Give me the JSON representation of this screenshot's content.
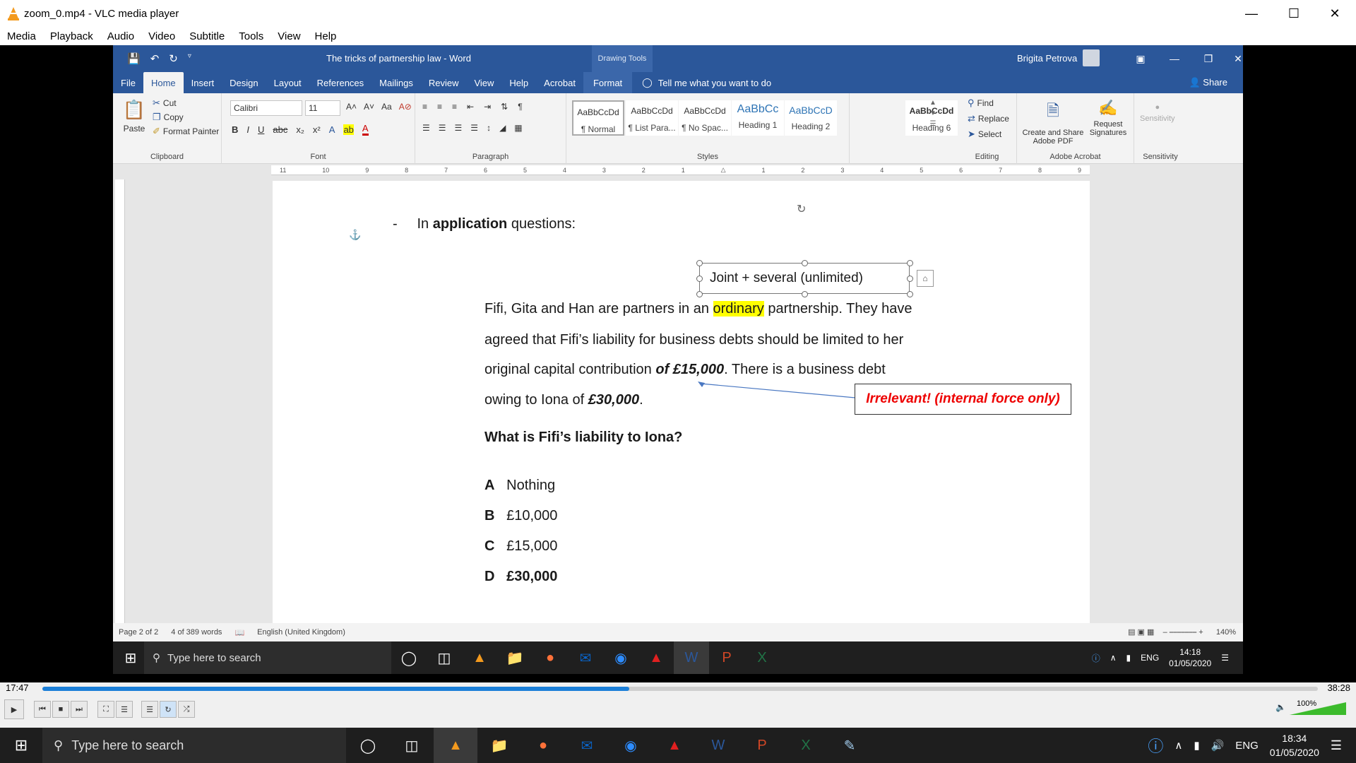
{
  "vlc": {
    "title": "zoom_0.mp4 - VLC media player",
    "menu": [
      "Media",
      "Playback",
      "Audio",
      "Video",
      "Subtitle",
      "Tools",
      "View",
      "Help"
    ],
    "time_elapsed": "17:47",
    "time_total": "38:28",
    "progress_fraction": 0.46,
    "volume": "100%"
  },
  "word": {
    "doc_title": "The tricks of partnership law  -  Word",
    "drawing_tools": "Drawing Tools",
    "user": "Brigita Petrova",
    "tabs": [
      "File",
      "Home",
      "Insert",
      "Design",
      "Layout",
      "References",
      "Mailings",
      "Review",
      "View",
      "Help",
      "Acrobat",
      "Format"
    ],
    "tell_me": "Tell me what you want to do",
    "share": "Share",
    "clipboard": {
      "paste": "Paste",
      "cut": "Cut",
      "copy": "Copy",
      "format_painter": "Format Painter",
      "label": "Clipboard"
    },
    "font": {
      "name": "Calibri",
      "size": "11",
      "label": "Font"
    },
    "paragraph_label": "Paragraph",
    "styles": {
      "label": "Styles",
      "items": [
        {
          "sample": "AaBbCcDd",
          "name": "¶ Normal"
        },
        {
          "sample": "AaBbCcDd",
          "name": "¶ List Para..."
        },
        {
          "sample": "AaBbCcDd",
          "name": "¶ No Spac..."
        },
        {
          "sample": "AaBbCc",
          "name": "Heading 1"
        },
        {
          "sample": "AaBbCcD",
          "name": "Heading 2"
        },
        {
          "sample": "AaBbCcDd",
          "name": "Heading 6"
        }
      ]
    },
    "editing": {
      "find": "Find",
      "replace": "Replace",
      "select": "Select",
      "label": "Editing"
    },
    "acrobat": {
      "create": "Create and Share Adobe PDF",
      "request": "Request Signatures",
      "label": "Adobe Acrobat"
    },
    "sensitivity": {
      "button": "Sensitivity",
      "label": "Sensitivity"
    },
    "document": {
      "bullet_prefix": "In ",
      "bullet_bold": "application",
      "bullet_suffix": " questions:",
      "textbox": "Joint + several (unlimited)",
      "line1_a": "Fifi, Gita and Han are partners in an ",
      "line1_hl": "ordinary",
      "line1_b": " partnership. They have",
      "line2": "agreed that Fifi’s liability for business debts should be limited to her",
      "line3_a": "original capital contribution ",
      "line3_b": "of £15,000",
      "line3_c": ". There is a business debt",
      "line4_a": "owing to Iona of ",
      "line4_b": "£30,000",
      "line4_c": ".",
      "question": "What is Fifi’s liability to Iona?",
      "callout": "Irrelevant! (internal force only)",
      "options": [
        {
          "letter": "A",
          "text": "Nothing"
        },
        {
          "letter": "B",
          "text": "£10,000"
        },
        {
          "letter": "C",
          "text": "£15,000"
        },
        {
          "letter": "D",
          "text": "£30,000"
        }
      ]
    },
    "status": {
      "page": "Page 2 of 2",
      "words": "4 of 389 words",
      "language": "English (United Kingdom)",
      "zoom": "140%"
    }
  },
  "inner_taskbar": {
    "search": "Type here to search",
    "lang": "ENG",
    "time": "14:18",
    "date": "01/05/2020"
  },
  "taskbar": {
    "search": "Type here to search",
    "lang": "ENG",
    "time": "18:34",
    "date": "01/05/2020"
  }
}
